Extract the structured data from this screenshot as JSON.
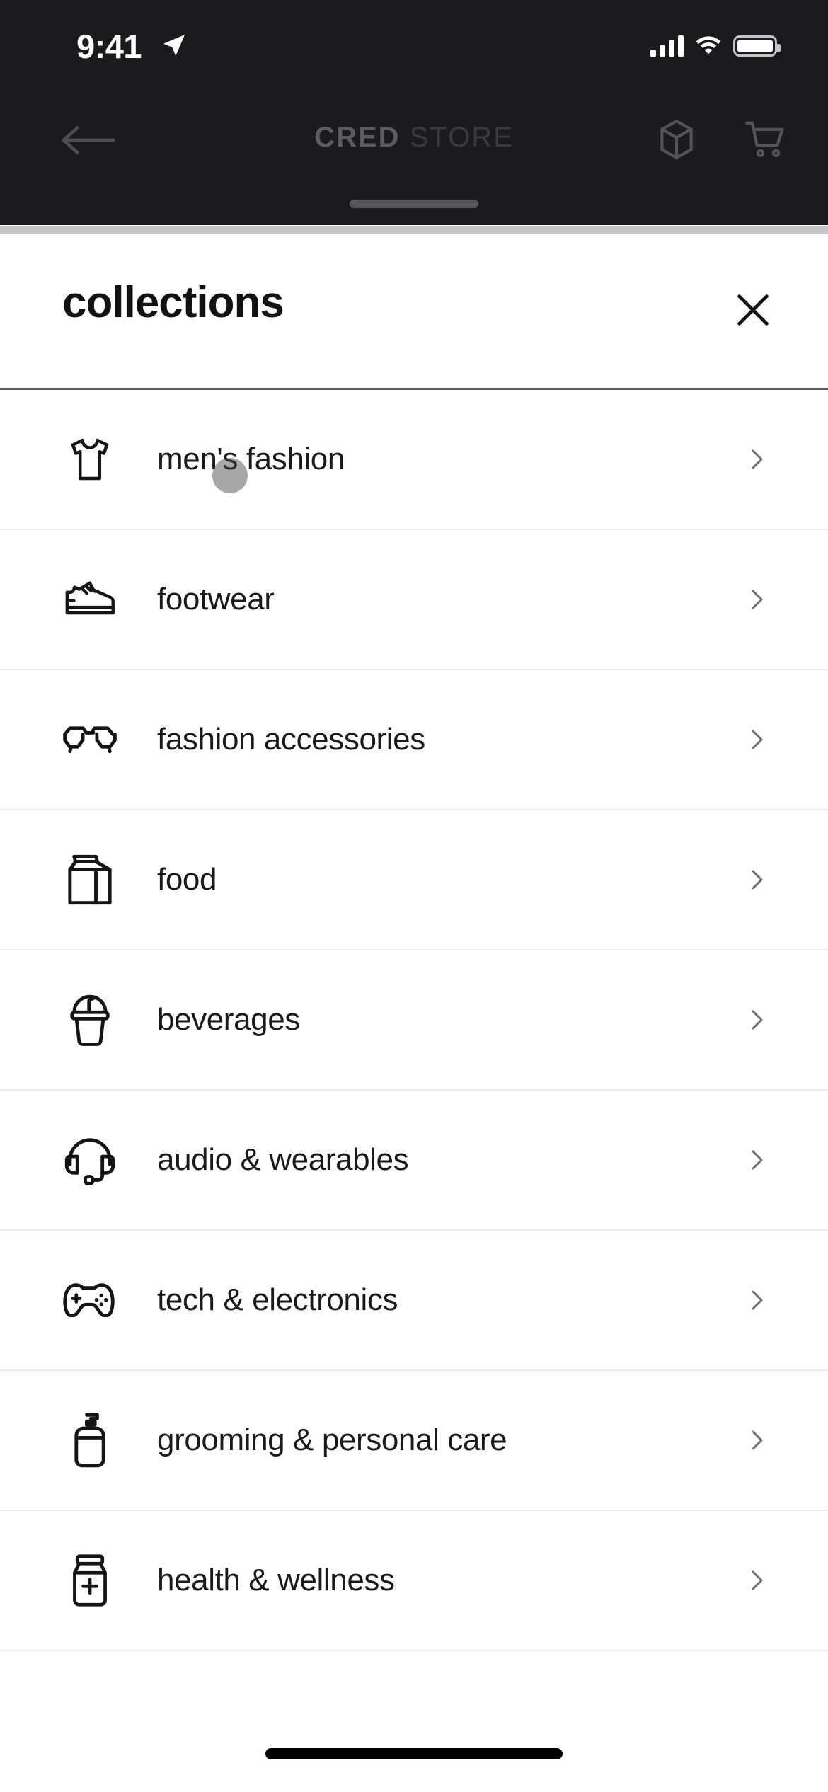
{
  "status_bar": {
    "time": "9:41",
    "location_icon": "location-arrow-icon",
    "cellular_icon": "cellular-signal-icon",
    "wifi_icon": "wifi-icon",
    "battery_icon": "battery-icon"
  },
  "app_bar": {
    "back_icon": "back-arrow-icon",
    "brand_primary": "CRED",
    "brand_secondary": "STORE",
    "orders_icon": "package-box-icon",
    "cart_icon": "shopping-cart-icon"
  },
  "sheet": {
    "title": "collections",
    "close_icon": "close-x-icon",
    "items": [
      {
        "label": "men's fashion",
        "icon": "tshirt-icon",
        "chevron": "chevron-right-icon"
      },
      {
        "label": "footwear",
        "icon": "sneaker-icon",
        "chevron": "chevron-right-icon"
      },
      {
        "label": "fashion accessories",
        "icon": "eyeglasses-icon",
        "chevron": "chevron-right-icon"
      },
      {
        "label": "food",
        "icon": "milk-carton-icon",
        "chevron": "chevron-right-icon"
      },
      {
        "label": "beverages",
        "icon": "drink-cup-icon",
        "chevron": "chevron-right-icon"
      },
      {
        "label": "audio & wearables",
        "icon": "headset-icon",
        "chevron": "chevron-right-icon"
      },
      {
        "label": "tech & electronics",
        "icon": "gamepad-icon",
        "chevron": "chevron-right-icon"
      },
      {
        "label": "grooming & personal care",
        "icon": "pump-bottle-icon",
        "chevron": "chevron-right-icon"
      },
      {
        "label": "health & wellness",
        "icon": "medicine-jar-icon",
        "chevron": "chevron-right-icon"
      }
    ]
  },
  "colors": {
    "app_background": "#1b1b1d",
    "sheet_background": "#ffffff",
    "text_primary": "#1a1a1c",
    "divider": "#ececed",
    "chevron": "#6d6d70",
    "tap_indicator": "rgba(70,70,70,0.47)"
  },
  "system": {
    "home_indicator": "home-indicator"
  }
}
